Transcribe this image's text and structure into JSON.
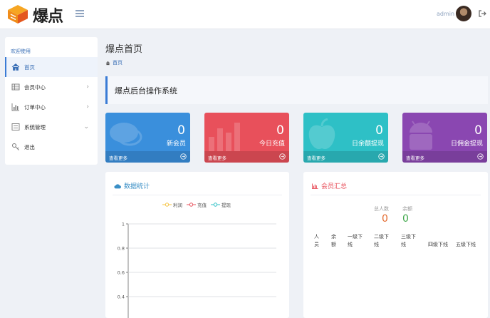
{
  "header": {
    "brand": "爆点",
    "admin_name": "admin"
  },
  "sidebar": {
    "title": "欢迎使用",
    "items": [
      {
        "label": "首页",
        "icon": "home-icon",
        "active": true
      },
      {
        "label": "会员中心",
        "icon": "table-icon"
      },
      {
        "label": "订单中心",
        "icon": "bar-chart-icon"
      },
      {
        "label": "系统管理",
        "icon": "list-icon"
      },
      {
        "label": "退出",
        "icon": "key-icon"
      }
    ]
  },
  "main": {
    "page_title": "爆点首页",
    "breadcrumb": "首页",
    "banner_text": "爆点后台操作系统"
  },
  "stats": [
    {
      "value": "0",
      "label": "新会员",
      "more": "查看更多",
      "color": "#3a8fdc"
    },
    {
      "value": "0",
      "label": "今日充值",
      "more": "查看更多",
      "color": "#e8505b"
    },
    {
      "value": "0",
      "label": "日余额提现",
      "more": "查看更多",
      "color": "#2ec0c6"
    },
    {
      "value": "0",
      "label": "日佣金提现",
      "more": "查看更多",
      "color": "#8a47b1"
    }
  ],
  "data_panel": {
    "title": "数据统计"
  },
  "member_panel": {
    "title": "会员汇总",
    "total_label": "总人数",
    "total_value": "0",
    "balance_label": "余额",
    "balance_value": "0",
    "columns": [
      "人员",
      "余额",
      "一级下线",
      "二级下线",
      "三级下线",
      "四级下线",
      "五级下线"
    ]
  },
  "chart_data": {
    "type": "line",
    "series": [
      {
        "name": "利润",
        "color": "#f5c342",
        "values": []
      },
      {
        "name": "充值",
        "color": "#e8505b",
        "values": []
      },
      {
        "name": "提现",
        "color": "#2ec0c6",
        "values": []
      }
    ],
    "y_ticks": [
      "1",
      "0.8",
      "0.6",
      "0.4"
    ],
    "ylim": [
      0,
      1
    ],
    "grid": true
  }
}
